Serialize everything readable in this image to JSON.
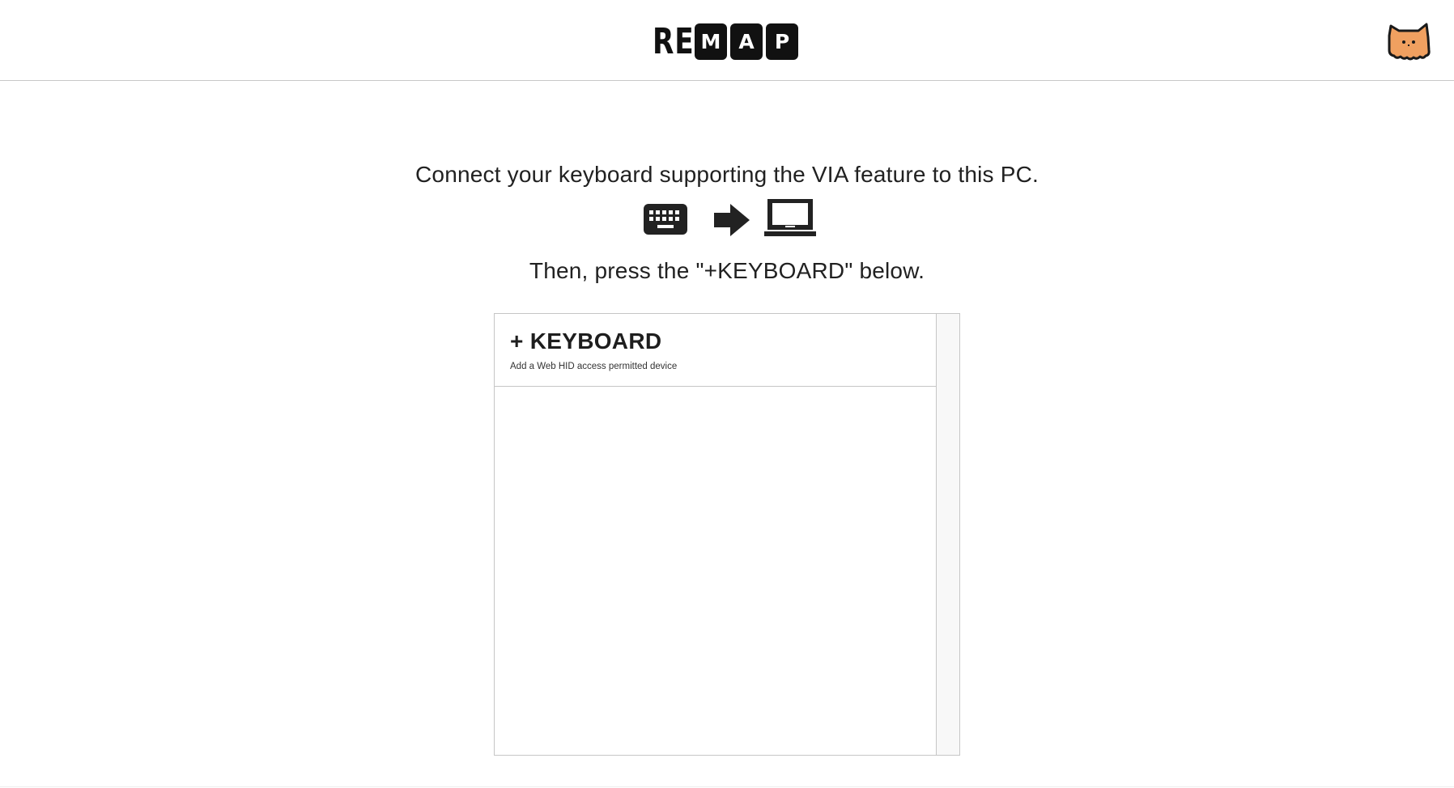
{
  "header": {
    "logo": {
      "plain": "RE",
      "boxed": [
        "M",
        "A",
        "P"
      ]
    },
    "mascot_icon": "orange-cat-mascot-icon"
  },
  "instructions": {
    "line1": "Connect your keyboard supporting the VIA feature to this PC.",
    "line2": "Then, press the \"+KEYBOARD\" below.",
    "icons": [
      "keyboard-icon",
      "arrow-right-icon",
      "laptop-icon"
    ]
  },
  "device_panel": {
    "add_keyboard": {
      "title": "+ KEYBOARD",
      "subtitle": "Add a Web HID access permitted device"
    }
  },
  "colors": {
    "mascot": "#f0a060",
    "border": "#c6c6c6",
    "text": "#212121"
  }
}
